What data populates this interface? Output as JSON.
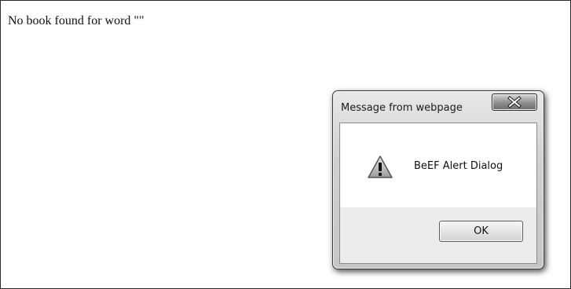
{
  "page": {
    "message": "No book found for word \"\""
  },
  "dialog": {
    "title": "Message from webpage",
    "message": "BeEF Alert Dialog",
    "ok_label": "OK",
    "close_label": "",
    "icon": "warning-icon"
  }
}
